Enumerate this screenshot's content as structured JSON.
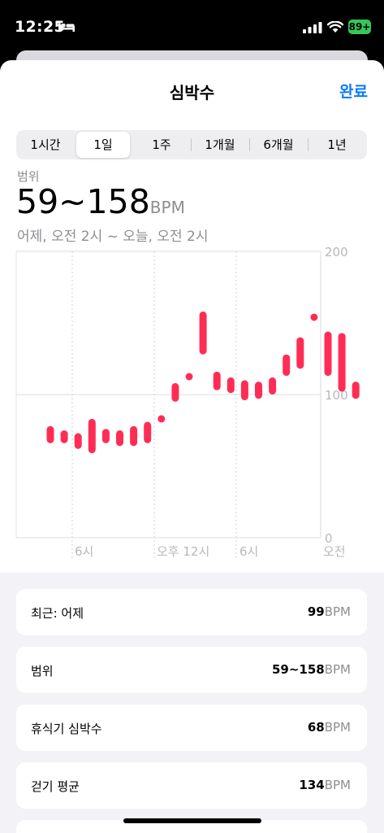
{
  "status_bar": {
    "time": "12:25",
    "battery": "89+"
  },
  "header": {
    "title": "심박수",
    "done_label": "완료"
  },
  "segments": [
    {
      "label": "1시간",
      "active": false
    },
    {
      "label": "1일",
      "active": true
    },
    {
      "label": "1주",
      "active": false
    },
    {
      "label": "1개월",
      "active": false
    },
    {
      "label": "6개월",
      "active": false
    },
    {
      "label": "1년",
      "active": false
    }
  ],
  "summary": {
    "range_label": "범위",
    "range_value": "59~158",
    "range_unit": "BPM",
    "period": "어제, 오전 2시 ~ 오늘, 오전 2시"
  },
  "chart_data": {
    "type": "bar",
    "subtype": "range",
    "color": "#ff2d55",
    "ylim": [
      0,
      200
    ],
    "yticks": [
      "200",
      "100",
      "0"
    ],
    "xticks": [
      "6시",
      "오후 12시",
      "6시",
      "오전"
    ],
    "grid": true,
    "series": [
      {
        "x": [
          1,
          2,
          3,
          4,
          5,
          6,
          7,
          8,
          9,
          10,
          11,
          12,
          13,
          14,
          15,
          16,
          17,
          18,
          19,
          20,
          21,
          22
        ],
        "ranges": [
          [
            66,
            78
          ],
          [
            66,
            75
          ],
          [
            62,
            73
          ],
          [
            59,
            83
          ],
          [
            66,
            76
          ],
          [
            64,
            75
          ],
          [
            64,
            78
          ],
          [
            66,
            81
          ],
          [
            81,
            85
          ],
          [
            95,
            108
          ],
          [
            110,
            115
          ],
          [
            128,
            158
          ],
          [
            103,
            116
          ],
          [
            101,
            112
          ],
          [
            96,
            110
          ],
          [
            97,
            109
          ],
          [
            100,
            112
          ],
          [
            113,
            128
          ],
          [
            118,
            140
          ],
          [
            154,
            154
          ],
          [
            113,
            144
          ],
          [
            102,
            143
          ],
          [
            97,
            109
          ]
        ]
      }
    ]
  },
  "stats": [
    {
      "label": "최근: 어제",
      "value": "99",
      "unit": "BPM"
    },
    {
      "label": "범위",
      "value": "59~158",
      "unit": "BPM"
    },
    {
      "label": "휴식기 심박수",
      "value": "68",
      "unit": "BPM"
    },
    {
      "label": "걷기 평균",
      "value": "134",
      "unit": "BPM"
    }
  ]
}
